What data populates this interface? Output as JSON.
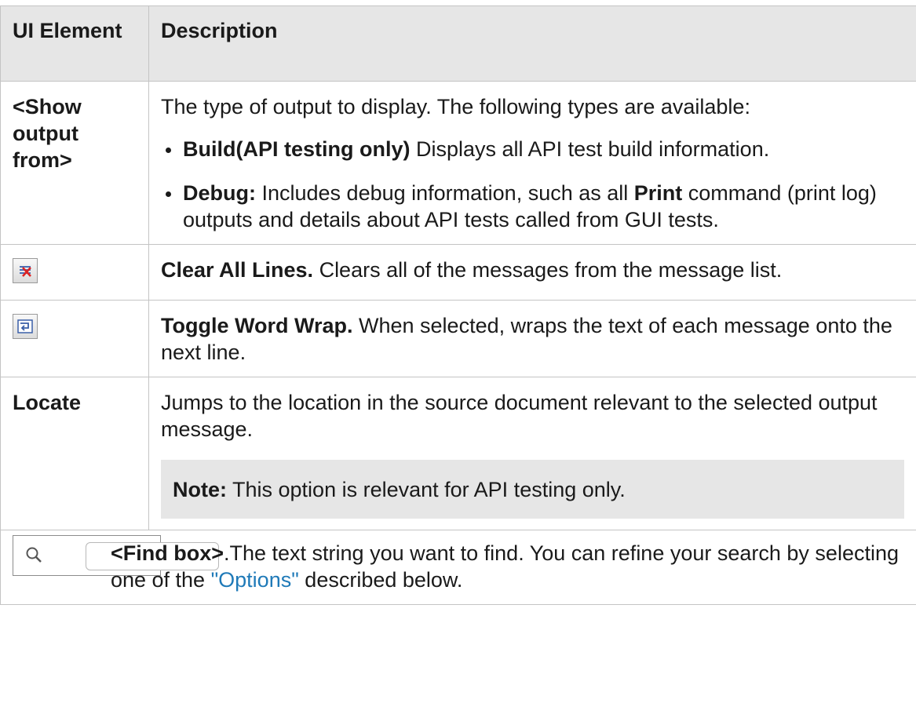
{
  "header": {
    "col_element": "UI Element",
    "col_description": "Description"
  },
  "rows": {
    "show_output": {
      "element": "<Show output from>",
      "intro": "The type of output to display. The following types are available:",
      "items": [
        {
          "bold": "Build(API testing only)",
          "text": " Displays all API test build information."
        },
        {
          "bold": "Debug:",
          "text": " Includes debug information, such as all ",
          "bold2": "Print",
          "text2": " command (print log) outputs and details about API tests called from GUI tests."
        }
      ]
    },
    "clear_all": {
      "icon": "clear-all-lines-icon",
      "bold": "Clear All Lines.",
      "text": " Clears all of the messages from the message list."
    },
    "word_wrap": {
      "icon": "toggle-word-wrap-icon",
      "bold": "Toggle Word Wrap.",
      "text": " When selected, wraps the text of each message onto the next line."
    },
    "locate": {
      "element": "Locate",
      "text": "Jumps to the location in the source document relevant to the selected output message.",
      "note_bold": "Note:",
      "note_text": " This option is relevant for API testing only."
    },
    "find": {
      "icon": "magnifier-icon",
      "bold": "<Find box>",
      "text": ".The text string you want to find. You can refine your search by selecting one of the ",
      "link": "\"Options\"",
      "text2": " described below."
    }
  },
  "colors": {
    "header_bg": "#e6e6e6",
    "link": "#1f7ab8",
    "border": "#c4c4c4"
  }
}
